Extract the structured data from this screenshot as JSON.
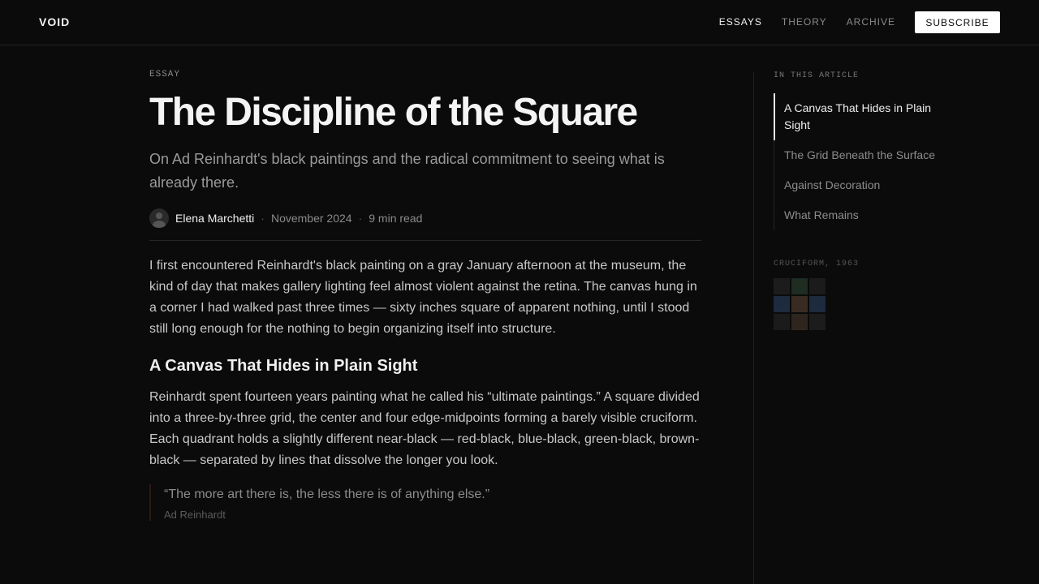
{
  "header": {
    "brand": "VOID",
    "nav": [
      "ESSAYS",
      "THEORY",
      "ARCHIVE"
    ],
    "active_nav": "ESSAYS",
    "subscribe_label": "SUBSCRIBE"
  },
  "article": {
    "kicker": "ESSAY",
    "title": "The Discipline of the Square",
    "subtitle": "On Ad Reinhardt's black paintings and the radical commitment to seeing what is already there.",
    "author": "Elena Marchetti",
    "date": "November 2024",
    "read_time": "9 min read",
    "separator": "·",
    "intro": "I first encountered Reinhardt's black painting on a gray January afternoon at the museum, the kind of day that makes gallery lighting feel almost violent against the retina. The canvas hung in a corner I had walked past three times — sixty inches square of apparent nothing, until I stood still long enough for the nothing to begin organizing itself into structure.",
    "section1_heading": "A Canvas That Hides in Plain Sight",
    "section1_body": "Reinhardt spent fourteen years painting what he called his “ultimate paintings.” A square divided into a three-by-three grid, the center and four edge-midpoints forming a barely visible cruciform. Each quadrant holds a slightly different near-black — red-black, blue-black, green-black, brown-black — separated by lines that dissolve the longer you look.",
    "quote_text": "“The more art there is, the less there is of anything else.”",
    "quote_cite": "Ad Reinhardt"
  },
  "sidebar": {
    "toc_label": "IN THIS ARTICLE",
    "toc_items": [
      "A Canvas That Hides in Plain Sight",
      "The Grid Beneath the Surface",
      "Against Decoration",
      "What Remains"
    ],
    "active_index": 0,
    "figure_label": "CRUCIFORM, 1963",
    "figure_colors": [
      "#1c1c1c",
      "#1e2c22",
      "#1b1b1b",
      "#1e2a3e",
      "#3a2b22",
      "#1e2a3e",
      "#1b1b1b",
      "#2e261e",
      "#1c1c1c"
    ]
  },
  "colors": {
    "background": "#0b0b0b",
    "accent": "#ffffff"
  }
}
